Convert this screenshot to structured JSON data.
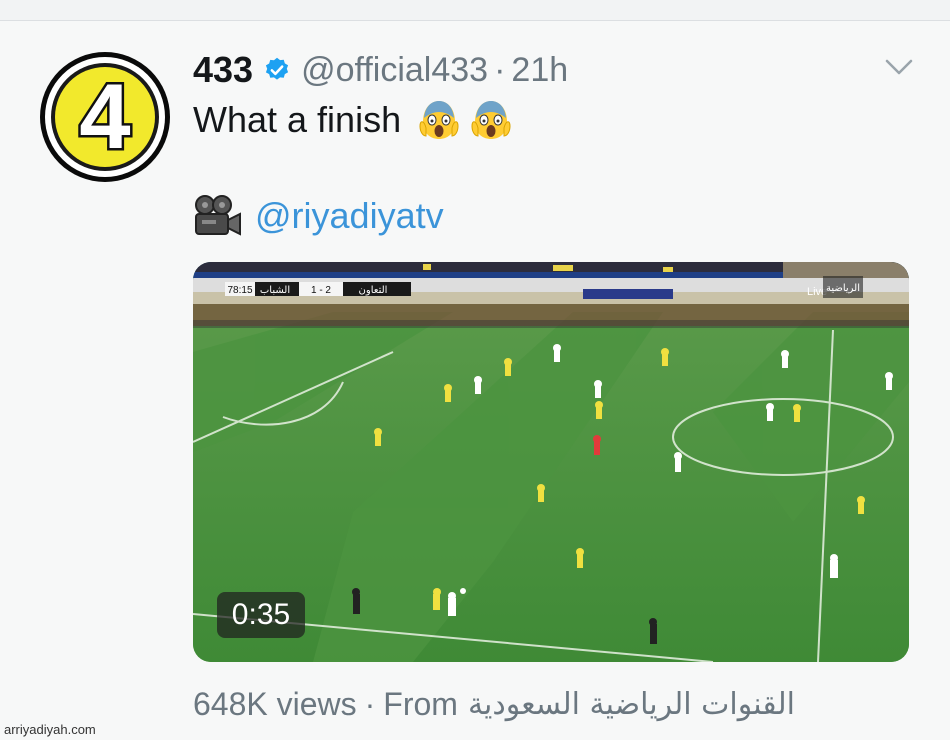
{
  "tweet": {
    "author_name": "433",
    "handle": "@official433",
    "separator": "·",
    "time": "21h",
    "text": "What a finish",
    "emojis": [
      "scream-emoji",
      "scream-emoji"
    ],
    "mention": "@riyadiyatv",
    "avatar_label": "4"
  },
  "video": {
    "duration": "0:35",
    "scoreboard": {
      "clock": "78:15",
      "team_right": "التعاون",
      "score": "1 - 2",
      "team_left": "الشباب"
    },
    "channel_label": "الرياضية",
    "live_label": "Live"
  },
  "footer": {
    "views": "648K views",
    "separator": "·",
    "from_label": "From",
    "source": "القنوات الرياضية السعودية"
  },
  "watermark": "arriyadiyah.com",
  "colors": {
    "link": "#3b94d9",
    "verified": "#1da1f2",
    "secondary_text": "#6b7780",
    "avatar_yellow": "#f2e92c"
  }
}
